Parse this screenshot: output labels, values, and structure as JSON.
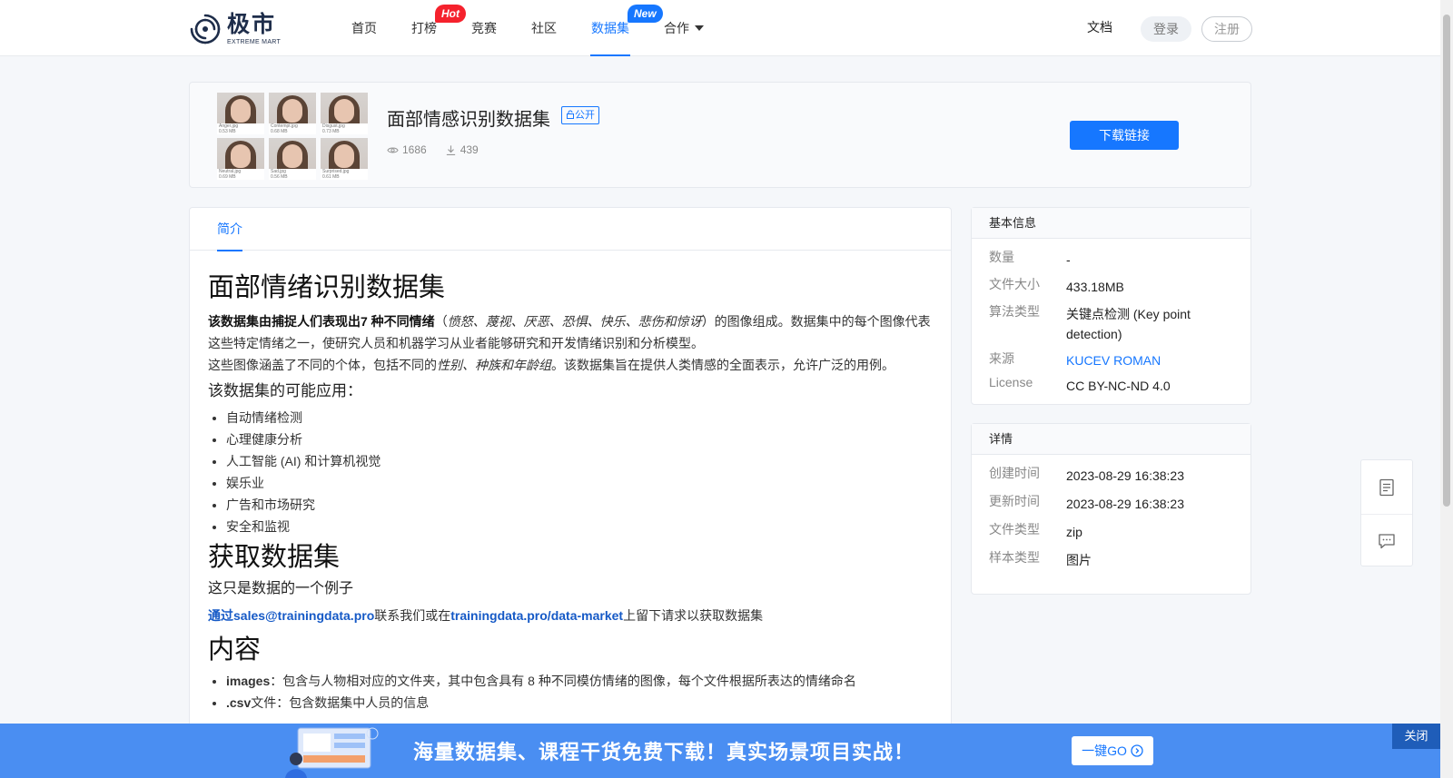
{
  "header": {
    "logo_cn": "极市",
    "logo_en": "EXTREME MART",
    "nav": [
      {
        "label": "首页"
      },
      {
        "label": "打榜",
        "badge": "Hot"
      },
      {
        "label": "竞赛"
      },
      {
        "label": "社区"
      },
      {
        "label": "数据集",
        "badge": "New",
        "active": true
      },
      {
        "label": "合作",
        "dropdown": true
      }
    ],
    "docs": "文档",
    "login": "登录",
    "register": "注册"
  },
  "hero": {
    "title": "面部情感识别数据集",
    "tag": "公开",
    "views": "1686",
    "downloads": "439",
    "download_button": "下载链接",
    "thumbnails": [
      {
        "name": "Anger.jpg",
        "size": "0.53 MB"
      },
      {
        "name": "Contempt.jpg",
        "size": "0.68 MB"
      },
      {
        "name": "Disgust.jpg",
        "size": "0.73 MB"
      },
      {
        "name": "Neutral.jpg",
        "size": "0.69 MB"
      },
      {
        "name": "Sad.jpg",
        "size": "0.56 MB"
      },
      {
        "name": "Surprised.jpg",
        "size": "0.61 MB"
      }
    ]
  },
  "tabs": {
    "intro": "简介"
  },
  "content": {
    "h1": "面部情绪识别数据集",
    "p1_bold": "该数据集由捕捉人们表现出7 种不同情绪",
    "p1_paren_open": "（",
    "p1_emotions": "愤怒、蔑视、厌恶、恐惧、快乐、悲伤和惊讶",
    "p1_rest": "）的图像组成。数据集中的每个图像代表这些特定情绪之一，使研究人员和机器学习从业者能够研究和开发情绪识别和分析模型。",
    "p2_a": "这些图像涵盖了不同的个体，包括不同的",
    "p2_italic": "性别、种族和年龄组",
    "p2_b": "。该数据集旨在提供人类情感的全面表示，允许广泛的用例。",
    "h3_apps": "该数据集的可能应用：",
    "apps": [
      "自动情绪检测",
      "心理健康分析",
      "人工智能 (AI) 和计算机视觉",
      "娱乐业",
      "广告和市场研究",
      "安全和监视"
    ],
    "h2_get": "获取数据集",
    "sample_note": "这只是数据的一个例子",
    "contact_link": "通过sales@trainingdata.pro",
    "contact_mid": "联系我们或在",
    "market_link": "trainingdata.pro/data-market",
    "contact_end": "上留下请求以获取数据集",
    "h2_contents": "内容",
    "contents_item1_key": "images",
    "contents_item1_text": "：包含与人物相对应的文件夹，其中包含具有 8 种不同模仿情绪的图像，每个文件根据所表达的情绪命名",
    "contents_item2_key": ".csv",
    "contents_item2_text": "文件：包含数据集中人员的信息"
  },
  "basic_info": {
    "title": "基本信息",
    "rows": [
      {
        "k": "数量",
        "v": "-"
      },
      {
        "k": "文件大小",
        "v": "433.18MB"
      },
      {
        "k": "算法类型",
        "v": "关键点检测 (Key point detection)"
      },
      {
        "k": "来源",
        "v": "KUCEV ROMAN"
      },
      {
        "k": "License",
        "v": "CC BY-NC-ND 4.0"
      }
    ]
  },
  "details": {
    "title": "详情",
    "rows": [
      {
        "k": "创建时间",
        "v": "2023-08-29 16:38:23"
      },
      {
        "k": "更新时间",
        "v": "2023-08-29 16:38:23"
      },
      {
        "k": "文件类型",
        "v": "zip"
      },
      {
        "k": "样本类型",
        "v": "图片"
      }
    ]
  },
  "banner": {
    "text": "海量数据集、课程干货免费下载！真实场景项目实战！",
    "go": "一键GO",
    "close": "关闭"
  },
  "colors": {
    "accent": "#1677ff",
    "hot": "#f5222d",
    "banner": "#4a8ef2"
  }
}
